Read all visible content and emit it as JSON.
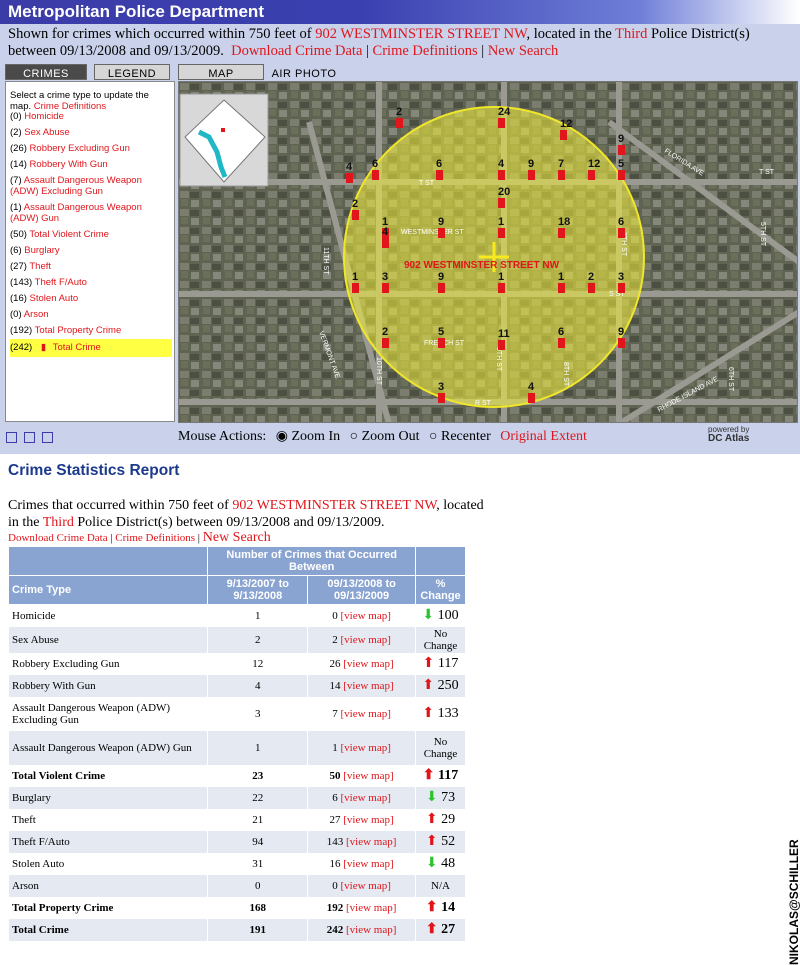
{
  "app_title": "Metropolitan Police Department",
  "intro": {
    "pre": "Shown for crimes which occurred within 750 feet of ",
    "address": "902 WESTMINSTER STREET NW",
    "mid": ", located in the ",
    "district": "Third",
    "post": " Police District(s) between 09/13/2008 and 09/13/2009.",
    "links": [
      "Download Crime Data",
      "Crime Definitions",
      "New Search"
    ]
  },
  "tabs": [
    "Crimes",
    "Legend",
    "Map",
    "Air Photo"
  ],
  "legend": {
    "intro": "Select a crime type to update the map.",
    "intro_link": "Crime Definitions",
    "items": [
      {
        "count": "(0)",
        "label": "Homicide"
      },
      {
        "count": "(2)",
        "label": "Sex Abuse"
      },
      {
        "count": "(26)",
        "label": "Robbery Excluding Gun"
      },
      {
        "count": "(14)",
        "label": "Robbery With Gun"
      },
      {
        "count": "(7)",
        "label": "Assault Dangerous Weapon (ADW) Excluding Gun"
      },
      {
        "count": "(1)",
        "label": "Assault Dangerous Weapon (ADW) Gun"
      },
      {
        "count": "(50)",
        "label": "Total Violent Crime"
      },
      {
        "count": "(6)",
        "label": "Burglary"
      },
      {
        "count": "(27)",
        "label": "Theft"
      },
      {
        "count": "(143)",
        "label": "Theft F/Auto"
      },
      {
        "count": "(16)",
        "label": "Stolen Auto"
      },
      {
        "count": "(0)",
        "label": "Arson"
      },
      {
        "count": "(192)",
        "label": "Total Property Crime"
      },
      {
        "count": "(242)",
        "label": "Total Crime"
      }
    ]
  },
  "map": {
    "address_label": "902 WESTMINSTER STREET NW",
    "streets": [
      "T ST",
      "WESTMINSTER ST",
      "S ST",
      "FRENCH ST",
      "R ST",
      "11TH ST",
      "10TH ST",
      "9TH ST",
      "8TH ST",
      "7TH ST",
      "VERMONT AVE",
      "FLORIDA AVE",
      "RHODE ISLAND AVE",
      "6TH ST",
      "5TH ST",
      "T ST"
    ],
    "markers": [
      "2",
      "24",
      "12",
      "9",
      "4",
      "6",
      "6",
      "4",
      "9",
      "7",
      "12",
      "5",
      "20",
      "2",
      "1",
      "4",
      "9",
      "1",
      "18",
      "6",
      "1",
      "3",
      "9",
      "1",
      "1",
      "2",
      "3",
      "2",
      "5",
      "11",
      "6",
      "9",
      "3",
      "4"
    ]
  },
  "mouse_actions": {
    "label": "Mouse Actions:",
    "options": [
      "Zoom In",
      "Zoom Out",
      "Recenter"
    ],
    "extent_link": "Original Extent"
  },
  "powered_by": {
    "line1": "powered by",
    "line2": "DC Atlas"
  },
  "report": {
    "title": "Crime Statistics Report",
    "desc_pre": "Crimes that occurred within 750 feet of ",
    "address": "902 WESTMINSTER STREET NW",
    "desc_mid": ", located in the ",
    "district": "Third",
    "desc_post": " Police District(s) between 09/13/2008 and 09/13/2009.",
    "links": [
      "Download Crime Data",
      "Crime Definitions",
      "New Search"
    ]
  },
  "table": {
    "group_header": "Number of Crimes that Occurred Between",
    "headers": [
      "Crime Type",
      "9/13/2007 to 9/13/2008",
      "09/13/2008 to 09/13/2009",
      "% Change"
    ],
    "view_map": "[view map]",
    "rows": [
      {
        "type": "Homicide",
        "prev": "1",
        "curr": "0",
        "change": "100",
        "dir": "down"
      },
      {
        "type": "Sex Abuse",
        "prev": "2",
        "curr": "2",
        "change": "No Change",
        "dir": "none"
      },
      {
        "type": "Robbery Excluding Gun",
        "prev": "12",
        "curr": "26",
        "change": "117",
        "dir": "up"
      },
      {
        "type": "Robbery With Gun",
        "prev": "4",
        "curr": "14",
        "change": "250",
        "dir": "up"
      },
      {
        "type": "Assault Dangerous Weapon (ADW) Excluding Gun",
        "prev": "3",
        "curr": "7",
        "change": "133",
        "dir": "up"
      },
      {
        "type": "Assault Dangerous Weapon (ADW) Gun",
        "prev": "1",
        "curr": "1",
        "change": "No Change",
        "dir": "none"
      },
      {
        "type": "Total Violent Crime",
        "prev": "23",
        "curr": "50",
        "change": "117",
        "dir": "up",
        "bold": true
      },
      {
        "type": "Burglary",
        "prev": "22",
        "curr": "6",
        "change": "73",
        "dir": "down"
      },
      {
        "type": "Theft",
        "prev": "21",
        "curr": "27",
        "change": "29",
        "dir": "up"
      },
      {
        "type": "Theft F/Auto",
        "prev": "94",
        "curr": "143",
        "change": "52",
        "dir": "up"
      },
      {
        "type": "Stolen Auto",
        "prev": "31",
        "curr": "16",
        "change": "48",
        "dir": "down"
      },
      {
        "type": "Arson",
        "prev": "0",
        "curr": "0",
        "change": "N/A",
        "dir": "none"
      },
      {
        "type": "Total Property Crime",
        "prev": "168",
        "curr": "192",
        "change": "14",
        "dir": "up",
        "bold": true
      },
      {
        "type": "Total Crime",
        "prev": "191",
        "curr": "242",
        "change": "27",
        "dir": "up",
        "bold": true
      }
    ]
  },
  "credit": "NIKOLAS@SCHILLER",
  "colors": {
    "header_blue": "#3c3ca8",
    "panel": "#c9d2ea",
    "link_red": "#e0161c",
    "table_header": "#8aa4d2",
    "up_arrow": "#e2141a",
    "down_arrow": "#2ec32e",
    "highlight": "#ffff44"
  }
}
